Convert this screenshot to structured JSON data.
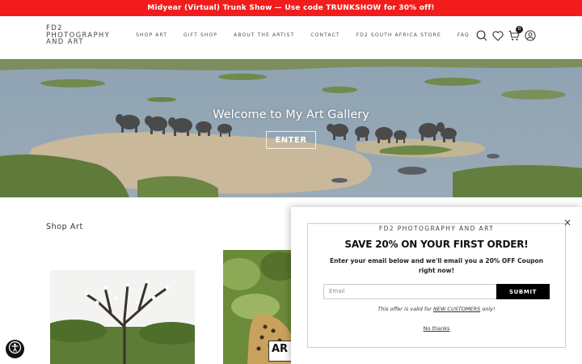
{
  "promo": {
    "text": "Midyear (Virtual) Trunk Show — Use code TRUNKSHOW for 30% off!"
  },
  "logo": {
    "line1": "FD2",
    "line2": "PHOTOGRAPHY",
    "line3": "AND ART"
  },
  "nav": {
    "items": [
      "SHOP ART",
      "GIFT SHOP",
      "ABOUT THE ARTIST",
      "CONTACT",
      "FD2 SOUTH AFRICA STORE",
      "FAQ"
    ]
  },
  "header_icons": {
    "search": "search-icon",
    "wishlist": "heart-icon",
    "cart": "cart-icon",
    "account": "user-icon",
    "cart_count": "0"
  },
  "hero": {
    "title": "Welcome to My Art Gallery",
    "button": "ENTER"
  },
  "shop": {
    "title": "Shop Art"
  },
  "products": [
    {
      "image": "tree-with-white-birds"
    },
    {
      "image": "leopard-in-foliage",
      "badge": "AR"
    }
  ],
  "popup": {
    "brand": "FD2 PHOTOGRAPHY AND ART",
    "heading": "SAVE 20% ON YOUR FIRST ORDER!",
    "subtext": "Enter your email below and we'll email you a 20% OFF Coupon right now!",
    "email_placeholder": "Email",
    "submit": "SUBMIT",
    "note_prefix": "This offer is valid for ",
    "note_link": "NEW CUSTOMERS",
    "note_suffix": " only!",
    "dismiss": "No thanks",
    "close": "×"
  },
  "accessibility": {
    "icon": "accessibility-icon"
  },
  "colors": {
    "promo_bg": "#f21c1c",
    "submit_bg": "#000000"
  }
}
